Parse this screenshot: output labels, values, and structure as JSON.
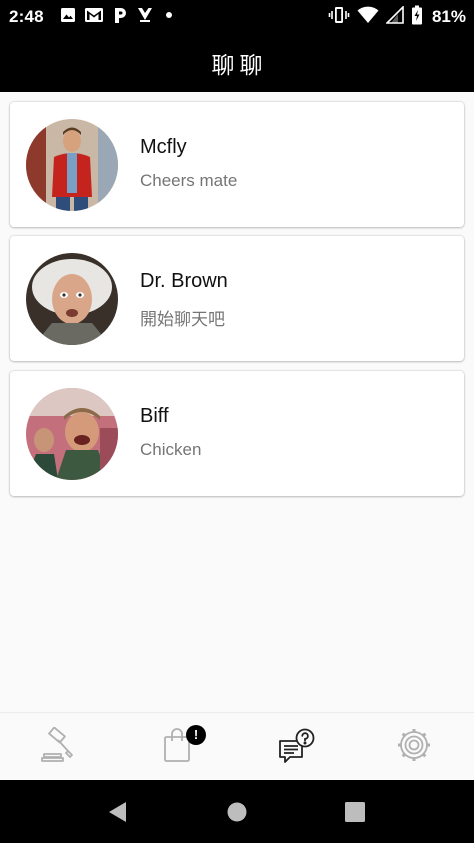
{
  "status_bar": {
    "time": "2:48",
    "battery": "81%",
    "left_icons": [
      "image-icon",
      "gmail-icon",
      "p-app-icon",
      "check-app-icon",
      "dot-icon"
    ],
    "right_icons": [
      "vibrate-icon",
      "wifi-icon",
      "signal-icon",
      "battery-icon"
    ]
  },
  "app_bar": {
    "title": "聊聊"
  },
  "chats": [
    {
      "name": "Mcfly",
      "preview": "Cheers mate",
      "avatar": "mcfly-avatar"
    },
    {
      "name": "Dr. Brown",
      "preview": "開始聊天吧",
      "avatar": "doc-brown-avatar"
    },
    {
      "name": "Biff",
      "preview": "Chicken",
      "avatar": "biff-avatar"
    }
  ],
  "bottom_nav": {
    "items": [
      "gavel-icon",
      "shopping-bag-icon",
      "chat-question-icon",
      "settings-gear-icon"
    ],
    "active_index": 2,
    "badge": "!"
  },
  "system_nav": {
    "buttons": [
      "back-button",
      "home-button",
      "recents-button"
    ]
  },
  "colors": {
    "app_bar": "#000000",
    "background": "#fafafa",
    "card": "#ffffff",
    "name_text": "#111111",
    "preview_text": "#757575",
    "inactive_icon": "#b0b0b0",
    "active_icon": "#222222"
  }
}
